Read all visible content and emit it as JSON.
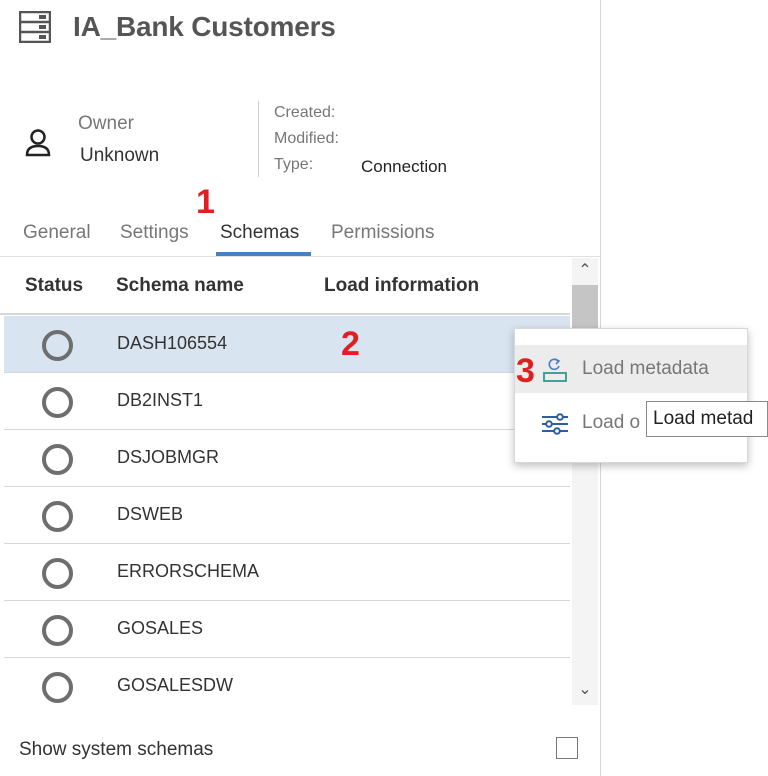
{
  "header": {
    "title": "IA_Bank Customers"
  },
  "owner": {
    "label": "Owner",
    "value": "Unknown"
  },
  "meta": {
    "created_label": "Created:",
    "modified_label": "Modified:",
    "type_label": "Type:",
    "type_value": "Connection"
  },
  "tabs": [
    {
      "label": "General"
    },
    {
      "label": "Settings"
    },
    {
      "label": "Schemas",
      "active": true
    },
    {
      "label": "Permissions"
    }
  ],
  "annotations": [
    "1",
    "2",
    "3"
  ],
  "table": {
    "columns": [
      "Status",
      "Schema name",
      "Load information"
    ],
    "rows": [
      {
        "name": "DASH106554",
        "selected": true
      },
      {
        "name": "DB2INST1"
      },
      {
        "name": "DSJOBMGR"
      },
      {
        "name": "DSWEB"
      },
      {
        "name": "ERRORSCHEMA"
      },
      {
        "name": "GOSALES"
      },
      {
        "name": "GOSALESDW"
      }
    ]
  },
  "scroll": {
    "up_glyph": "⌃",
    "down_glyph": "⌄"
  },
  "footer": {
    "show_system_label": "Show system schemas",
    "checked": false
  },
  "context_menu": {
    "items": [
      {
        "label": "Load metadata",
        "icon": "load-metadata-icon"
      },
      {
        "label": "Load o",
        "icon": "sliders-icon"
      }
    ]
  },
  "tooltip": {
    "text": "Load metad"
  },
  "colors": {
    "accent": "#4a7fc1",
    "selected_row": "#d9e4f1",
    "annotation": "#e02020"
  }
}
